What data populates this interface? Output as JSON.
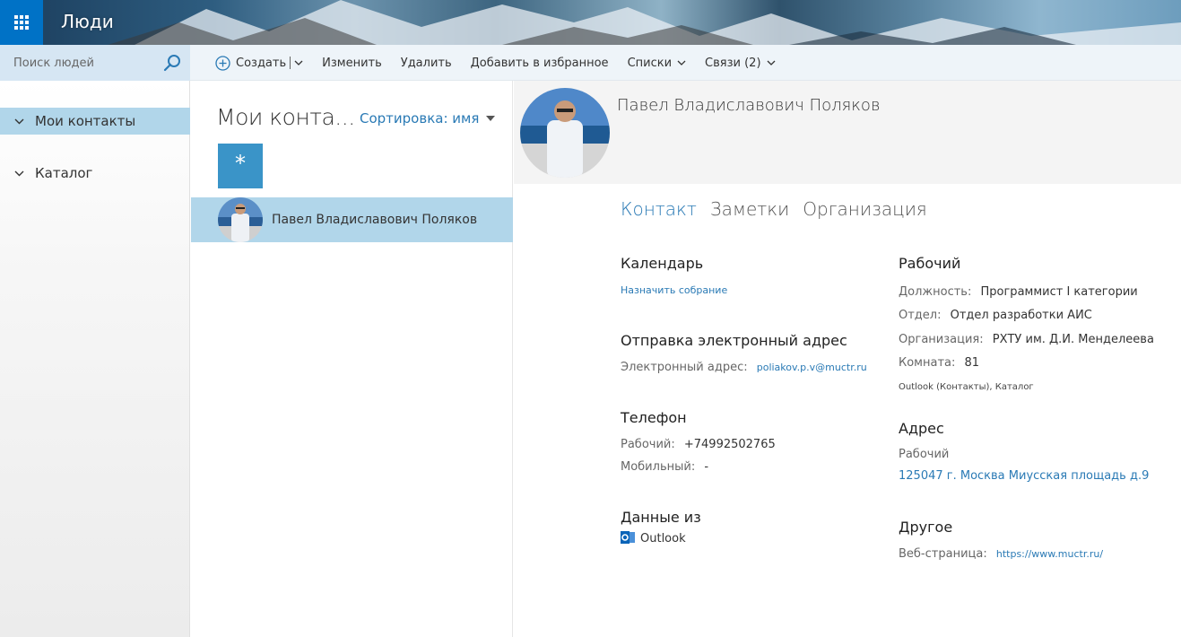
{
  "app": {
    "title": "Люди"
  },
  "search": {
    "placeholder": "Поиск людей"
  },
  "toolbar": {
    "create": "Создать",
    "edit": "Изменить",
    "delete": "Удалить",
    "favorite": "Добавить в избранное",
    "lists": "Списки",
    "links": "Связи (2)"
  },
  "nav": {
    "items": [
      {
        "label": "Мои контакты",
        "selected": true
      },
      {
        "label": "Каталог",
        "selected": false
      }
    ]
  },
  "list": {
    "title": "Мои конта...",
    "sort_label": "Сортировка: имя",
    "star": "*",
    "contacts": [
      {
        "name": "Павел Владиславович Поляков"
      }
    ]
  },
  "detail": {
    "name": "Павел Владиславович Поляков",
    "tabs": [
      "Контакт",
      "Заметки",
      "Организация"
    ],
    "calendar": {
      "title": "Календарь",
      "link": "Назначить собрание"
    },
    "email": {
      "title": "Отправка электронный адрес",
      "label": "Электронный адрес:",
      "value": "poliakov.p.v@muctr.ru"
    },
    "phone": {
      "title": "Телефон",
      "work_label": "Рабочий:",
      "work_value": "+74992502765",
      "mobile_label": "Мобильный:",
      "mobile_value": "-"
    },
    "source": {
      "title": "Данные из",
      "value": "Outlook"
    },
    "work": {
      "title": "Рабочий",
      "position_label": "Должность:",
      "position_value": "Программист I категории",
      "dept_label": "Отдел:",
      "dept_value": "Отдел разработки АИС",
      "org_label": "Организация:",
      "org_value": "РХТУ им. Д.И. Менделеева",
      "room_label": "Комната:",
      "room_value": "81",
      "sources": "Outlook (Контакты), Каталог"
    },
    "address": {
      "title": "Адрес",
      "type": "Рабочий",
      "value": "125047 г. Москва Миусская площадь д.9"
    },
    "other": {
      "title": "Другое",
      "web_label": "Веб-страница:",
      "web_value": "https://www.muctr.ru/"
    }
  },
  "colors": {
    "accent": "#0072c6",
    "link": "#2a7ab5",
    "selected": "#b1d6ea"
  }
}
